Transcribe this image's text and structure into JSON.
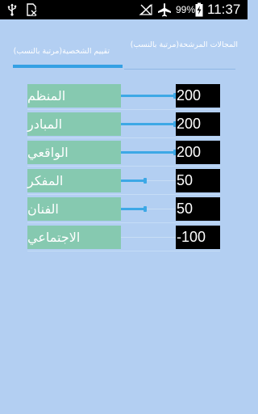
{
  "status_bar": {
    "battery": "99%",
    "time": "11:37"
  },
  "tabs": [
    {
      "label": "تقييم الشخصية(مرتبة بالنسب)",
      "selected": true
    },
    {
      "label": "المجالات المرشحة(مرتبة بالنسب)",
      "selected": false
    }
  ],
  "traits": [
    {
      "label": "المنظم",
      "score": "200",
      "level": 1.0
    },
    {
      "label": "المبادر",
      "score": "200",
      "level": 1.0
    },
    {
      "label": "الواقعي",
      "score": "200",
      "level": 1.0
    },
    {
      "label": "المفكر",
      "score": "50",
      "level": 0.5
    },
    {
      "label": "الفنان",
      "score": "50",
      "level": 0.5
    },
    {
      "label": "الاجتماعي",
      "score": "-100",
      "level": 0.0
    }
  ],
  "colors": {
    "background": "#b3cff2",
    "accent": "#35a0e4",
    "label_bg": "#86c9b0",
    "score_bg": "#000000"
  }
}
